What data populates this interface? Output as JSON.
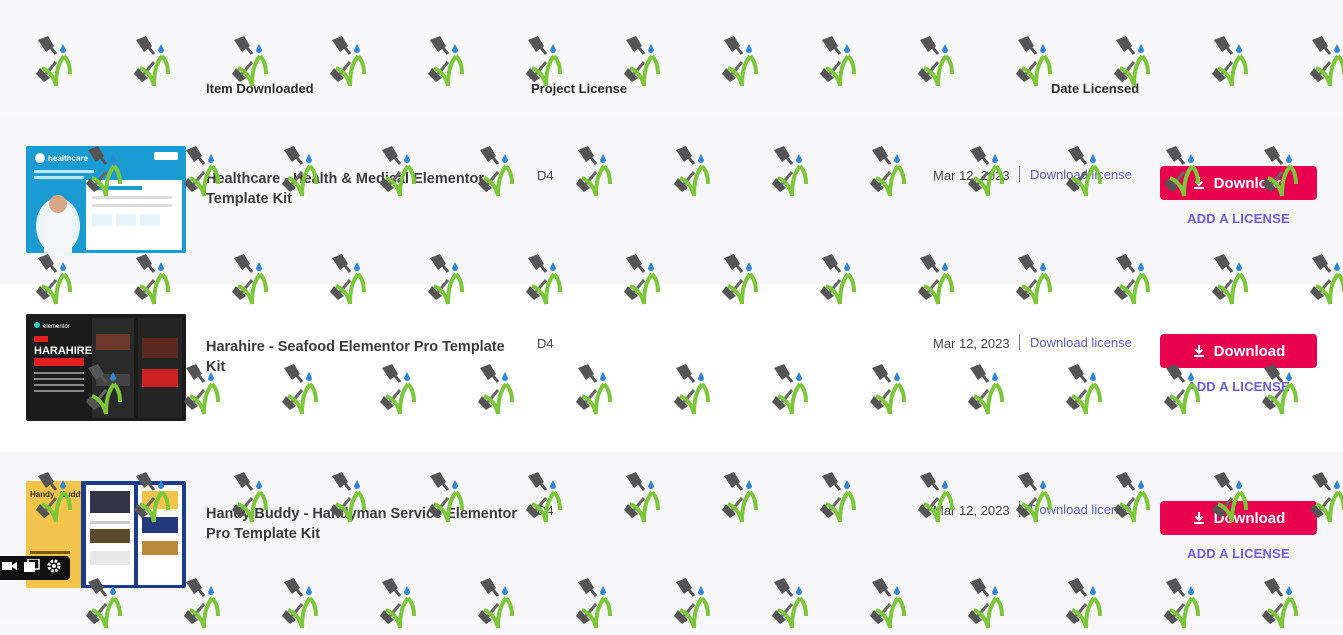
{
  "columns": {
    "item": "Item Downloaded",
    "license": "Project License",
    "date": "Date Licensed"
  },
  "rows": [
    {
      "title": "Healthcare - Health & Medical Elementor Template Kit",
      "license_code": "D4",
      "date": "Mar 12, 2023",
      "download_license_label": "Download license",
      "download_label": "Download",
      "add_license_label": "ADD A LICENSE",
      "thumb": {
        "bg": "#1a9cd2",
        "brand": "healthcare",
        "logo": "envato"
      }
    },
    {
      "title": "Harahire - Seafood Elementor Pro Template Kit",
      "license_code": "D4",
      "date": "Mar 12, 2023",
      "download_license_label": "Download license",
      "download_label": "Download",
      "add_license_label": "ADD A LICENSE",
      "thumb": {
        "bg": "#1b1b1b",
        "brand": "HARAHIRE",
        "logo": "elementor"
      }
    },
    {
      "title": "Handy Buddy - Handyman Service Elementor Pro Template Kit",
      "license_code": "D4",
      "date": "Mar 12, 2023",
      "download_license_label": "Download license",
      "download_label": "Download",
      "add_license_label": "ADD A LICENSE",
      "thumb": {
        "bg": "#f2c44c",
        "brand": "Handy Buddy",
        "logo": ""
      }
    }
  ],
  "colors": {
    "accent": "#e8004f",
    "link": "#5a5ad0",
    "add_license": "#6c5ce7"
  },
  "toolbar": {
    "icons": [
      "video-camera-icon",
      "copy-icon",
      "gear-icon"
    ]
  }
}
